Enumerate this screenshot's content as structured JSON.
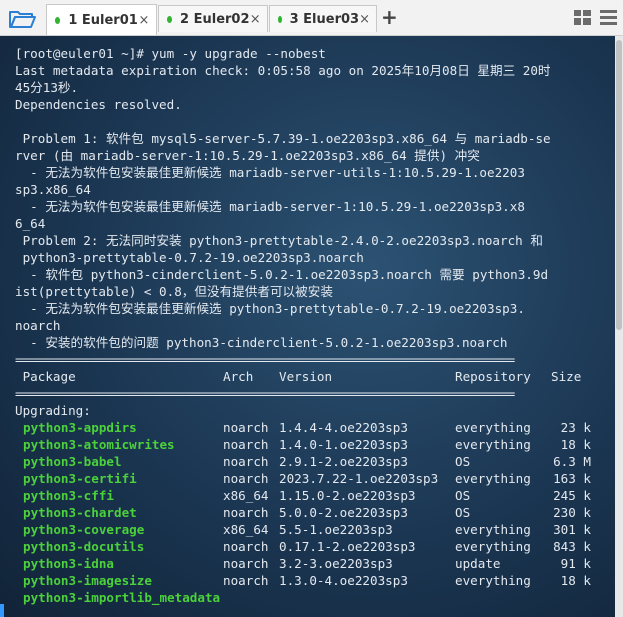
{
  "tabs": [
    {
      "label": "1 Euler01",
      "active": true
    },
    {
      "label": "2 Euler02",
      "active": false
    },
    {
      "label": "3 Eluer03",
      "active": false
    }
  ],
  "tab_close": "×",
  "add_tab": "+",
  "icons": {
    "folder": "folder-open-icon",
    "grid": "grid-view-icon",
    "menu": "hamburger-menu-icon"
  },
  "colors": {
    "terminal_bg": "#1b3652",
    "text": "#e3e9ef",
    "package_green": "#4bd13a",
    "tab_dot": "#2fb52f"
  },
  "terminal": {
    "prompt": "[root@euler01 ~]# yum -y upgrade --nobest",
    "meta1": "Last metadata expiration check: 0:05:58 ago on 2025年10月08日 星期三 20时",
    "meta2": "45分13秒.",
    "deps": "Dependencies resolved.",
    "blank": "",
    "p1_l1": " Problem 1: 软件包 mysql5-server-5.7.39-1.oe2203sp3.x86_64 与 mariadb-se",
    "p1_l2": "rver (由 mariadb-server-1:10.5.29-1.oe2203sp3.x86_64 提供) 冲突",
    "p1_l3": "  - 无法为软件包安装最佳更新候选 mariadb-server-utils-1:10.5.29-1.oe2203",
    "p1_l4": "sp3.x86_64",
    "p1_l5": "  - 无法为软件包安装最佳更新候选 mariadb-server-1:10.5.29-1.oe2203sp3.x8",
    "p1_l6": "6_64",
    "p2_l1": " Problem 2: 无法同时安装 python3-prettytable-2.4.0-2.oe2203sp3.noarch 和",
    "p2_l2": " python3-prettytable-0.7.2-19.oe2203sp3.noarch",
    "p2_l3": "  - 软件包 python3-cinderclient-5.0.2-1.oe2203sp3.noarch 需要 python3.9d",
    "p2_l4": "ist(prettytable) < 0.8，但没有提供者可以被安装",
    "p2_l5": "  - 无法为软件包安装最佳更新候选 python3-prettytable-0.7.2-19.oe2203sp3.",
    "p2_l6": "noarch",
    "p2_l7": "  - 安装的软件包的问题 python3-cinderclient-5.0.2-1.oe2203sp3.noarch",
    "separator": "==================================================================================",
    "header": {
      "package": " Package",
      "arch": "Arch",
      "version": "Version",
      "repository": "Repository",
      "size": "Size"
    },
    "upgrading": "Upgrading:",
    "packages": [
      {
        "name": "python3-appdirs",
        "arch": "noarch",
        "version": "1.4.4-4.oe2203sp3",
        "repo": "everything",
        "size": "23 k"
      },
      {
        "name": "python3-atomicwrites",
        "arch": "noarch",
        "version": "1.4.0-1.oe2203sp3",
        "repo": "everything",
        "size": "18 k"
      },
      {
        "name": "python3-babel",
        "arch": "noarch",
        "version": "2.9.1-2.oe2203sp3",
        "repo": "OS",
        "size": "6.3 M"
      },
      {
        "name": "python3-certifi",
        "arch": "noarch",
        "version": "2023.7.22-1.oe2203sp3",
        "repo": "everything",
        "size": "163 k"
      },
      {
        "name": "python3-cffi",
        "arch": "x86_64",
        "version": "1.15.0-2.oe2203sp3",
        "repo": "OS",
        "size": "245 k"
      },
      {
        "name": "python3-chardet",
        "arch": "noarch",
        "version": "5.0.0-2.oe2203sp3",
        "repo": "OS",
        "size": "230 k"
      },
      {
        "name": "python3-coverage",
        "arch": "x86_64",
        "version": "5.5-1.oe2203sp3",
        "repo": "everything",
        "size": "301 k"
      },
      {
        "name": "python3-docutils",
        "arch": "noarch",
        "version": "0.17.1-2.oe2203sp3",
        "repo": "everything",
        "size": "843 k"
      },
      {
        "name": "python3-idna",
        "arch": "noarch",
        "version": "3.2-3.oe2203sp3",
        "repo": "update",
        "size": "91 k"
      },
      {
        "name": "python3-imagesize",
        "arch": "noarch",
        "version": "1.3.0-4.oe2203sp3",
        "repo": "everything",
        "size": "18 k"
      },
      {
        "name": "python3-importlib_metadata",
        "arch": "",
        "version": "",
        "repo": "",
        "size": ""
      }
    ]
  }
}
